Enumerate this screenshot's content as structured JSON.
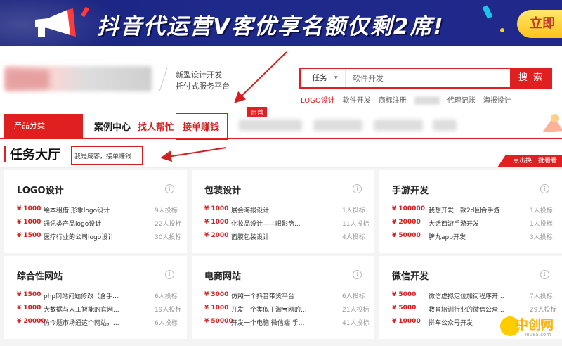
{
  "banner": {
    "title": "抖音代运营V客优享名额仅剩2席!",
    "cta": "立即"
  },
  "header": {
    "slogan_line1": "新型设计开发",
    "slogan_line2": "托付式服务平台",
    "search": {
      "category": "任务",
      "placeholder": "软件开发",
      "button": "搜 索"
    },
    "hot_links": [
      "LOGO设计",
      "软件开发",
      "商标注册",
      "代理记账",
      "海报设计"
    ]
  },
  "nav": {
    "category_label": "产品分类",
    "items": [
      "案例中心",
      "找人帮忙",
      "接单赚钱"
    ],
    "self_badge": "自营"
  },
  "hall": {
    "title": "任务大厅",
    "tagline": "我是威客，接单赚钱",
    "refresh": "点击换一批看看"
  },
  "categories": [
    {
      "title": "LOGO设计",
      "tasks": [
        {
          "price": "¥ 1000",
          "name": "绘本租借 形象logo设计",
          "bids": "9人投标"
        },
        {
          "price": "¥ 1000",
          "name": "通讯类产品logo设计",
          "bids": "22人投标"
        },
        {
          "price": "¥ 1500",
          "name": "医疗行业的公司logo设计",
          "bids": "30人投标"
        }
      ]
    },
    {
      "title": "包装设计",
      "tasks": [
        {
          "price": "¥ 1000",
          "name": "展会海报设计",
          "bids": "1人投标"
        },
        {
          "price": "¥ 1000",
          "name": "化妆品设计——眼影盘...",
          "bids": "11人投标"
        },
        {
          "price": "¥ 2000",
          "name": "面膜包装设计",
          "bids": "4人投标"
        }
      ]
    },
    {
      "title": "手游开发",
      "tasks": [
        {
          "price": "¥ 100000",
          "name": "我想开发一款2d回合手游",
          "bids": "1人投标"
        },
        {
          "price": "¥ 20000",
          "name": "大话西游手游开发",
          "bids": "1人投标"
        },
        {
          "price": "¥ 50000",
          "name": "脾九app开发",
          "bids": "3人投标"
        }
      ]
    },
    {
      "title": "综合性网站",
      "tasks": [
        {
          "price": "¥ 1500",
          "name": "php网站问题修改（含手...",
          "bids": "6人投标"
        },
        {
          "price": "¥ 1000",
          "name": "大数据与人工智能的官网...",
          "bids": "19人投标"
        },
        {
          "price": "¥ 20000",
          "name": "仿今题市场通这个网站，...",
          "bids": "6人投标"
        }
      ]
    },
    {
      "title": "电商网站",
      "tasks": [
        {
          "price": "¥ 3000",
          "name": "仿照一个抖音带货平台",
          "bids": "6人投标"
        },
        {
          "price": "¥ 1000",
          "name": "开发一个类似于淘宝网的...",
          "bids": "21人投标"
        },
        {
          "price": "¥ 50000",
          "name": "开发一个电脑 微信端 手...",
          "bids": "41人投标"
        }
      ]
    },
    {
      "title": "微信开发",
      "tasks": [
        {
          "price": "¥ 5000",
          "name": "微信虚拟定位加街程序开...",
          "bids": "7人投标"
        },
        {
          "price": "¥ 5000",
          "name": "教育培训行业的微信公众...",
          "bids": "29人投标"
        },
        {
          "price": "¥ 10000",
          "name": "拼车公众号开发",
          "bids": "5人投标"
        }
      ]
    }
  ],
  "watermark": {
    "text": "中创网",
    "sub": "You85.com"
  },
  "colors": {
    "brand_red": "#e02020",
    "banner_blue": "#1e2a8a"
  }
}
